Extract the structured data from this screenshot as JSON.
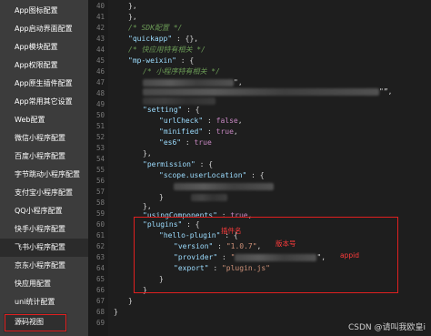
{
  "sidebar": {
    "items": [
      {
        "label": "App图标配置"
      },
      {
        "label": "App启动界面配置"
      },
      {
        "label": "App模块配置"
      },
      {
        "label": "App权限配置"
      },
      {
        "label": "App原生插件配置"
      },
      {
        "label": "App常用其它设置"
      },
      {
        "label": "Web配置"
      },
      {
        "label": "微信小程序配置"
      },
      {
        "label": "百度小程序配置"
      },
      {
        "label": "字节跳动小程序配置"
      },
      {
        "label": "支付宝小程序配置"
      },
      {
        "label": "QQ小程序配置"
      },
      {
        "label": "快手小程序配置"
      },
      {
        "label": "飞书小程序配置"
      },
      {
        "label": "京东小程序配置"
      },
      {
        "label": "快应用配置"
      },
      {
        "label": "uni统计配置"
      },
      {
        "label": "源码视图"
      }
    ],
    "active_index": 13,
    "highlight_index": 17
  },
  "gutter": {
    "line_numbers": [
      "40",
      "41",
      "42",
      "43",
      "44",
      "45",
      "46",
      "47",
      "48",
      "49",
      "50",
      "51",
      "52",
      "53",
      "54",
      "55",
      "56",
      "57",
      "58",
      "59",
      "60",
      "61",
      "62",
      "63",
      "64",
      "65",
      "66",
      "67",
      "68",
      "69"
    ]
  },
  "code": {
    "l40": "},",
    "l41": "},",
    "l42": "/* SDK配置 */",
    "l43_key": "\"quickapp\"",
    "l43_val": " : {},",
    "l44": "/* 快应用特有相关 */",
    "l45_key": "\"mp-weixin\"",
    "l45_val": " : {",
    "l46": "/* 小程序特有相关 */",
    "l47_end": "\",",
    "l48_end": "\"”,",
    "l49": "",
    "l50_key": "\"setting\"",
    "l50_val": " : {",
    "l51_key": "\"urlCheck\"",
    "l51_val": "false",
    "l52_key": "\"minified\"",
    "l52_val": "true",
    "l53_key": "\"es6\"",
    "l53_val": "true",
    "l54": "},",
    "l55_key": "\"permission\"",
    "l55_val": " : {",
    "l56_key": "\"scope.userLocation\"",
    "l56_val": " : {",
    "l57": "",
    "l58": "}",
    "l59": "},",
    "l60_key": "\"usingComponents\"",
    "l60_val": "true",
    "l61_key": "\"plugins\"",
    "l61_val": " : {",
    "l62_key": "\"hello-plugin\"",
    "l62_val": " : {",
    "l63_key": "\"version\"",
    "l63_val": "\"1.0.7\"",
    "l64_key": "\"provider\"",
    "l64_val": "\"",
    "l65_key": "\"export\"",
    "l65_val": "\"plugin.js\"",
    "l66": "}",
    "l67": "}",
    "l68": "}",
    "l69": "}"
  },
  "annotations": {
    "plugin_name": "插件名",
    "version": "版本号",
    "appid": "appid"
  },
  "watermark": "CSDN @请叫我欧皇i",
  "colors": {
    "sidebar_bg": "#3c3c3c",
    "editor_bg": "#1e1e1e",
    "annotation_red": "#e02020"
  }
}
